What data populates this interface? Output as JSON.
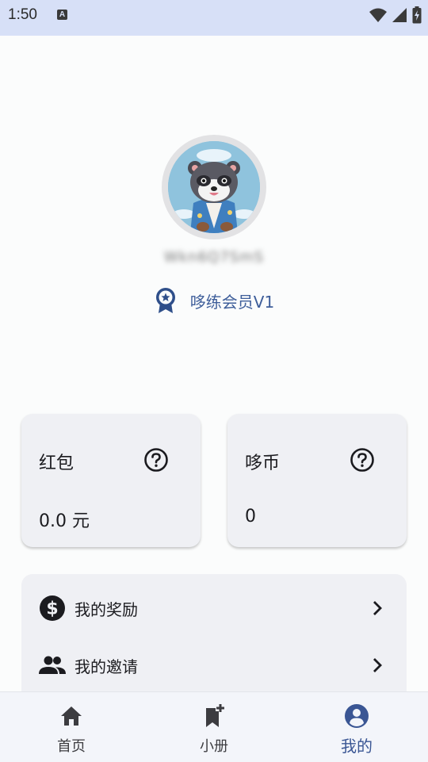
{
  "status_bar": {
    "time": "1:50",
    "notification_icon": "a-letter-icon",
    "icons": [
      "wifi-icon",
      "cellular-signal-icon",
      "battery-charging-icon"
    ]
  },
  "profile": {
    "avatar": "pixel-art-raccoon-avatar",
    "username": "Wkn6Q7SmS",
    "membership_label": "哆练会员V1",
    "membership_icon": "award-badge-icon"
  },
  "cards": [
    {
      "title": "红包",
      "value": "0.0 元",
      "help_icon": "help-circle-icon"
    },
    {
      "title": "哆币",
      "value": "0",
      "help_icon": "help-circle-icon"
    }
  ],
  "menu": [
    {
      "label": "我的奖励",
      "icon": "dollar-circle-icon"
    },
    {
      "label": "我的邀请",
      "icon": "people-icon"
    }
  ],
  "bottom_nav": {
    "items": [
      {
        "label": "首页",
        "icon": "home-icon"
      },
      {
        "label": "小册",
        "icon": "bookmark-add-icon"
      },
      {
        "label": "我的",
        "icon": "account-circle-icon",
        "active": true
      }
    ]
  },
  "colors": {
    "status_bar_bg": "#d7e0f7",
    "accent": "#3a5694",
    "card_bg": "#eff0f4",
    "page_bg": "#fbfcfc"
  }
}
